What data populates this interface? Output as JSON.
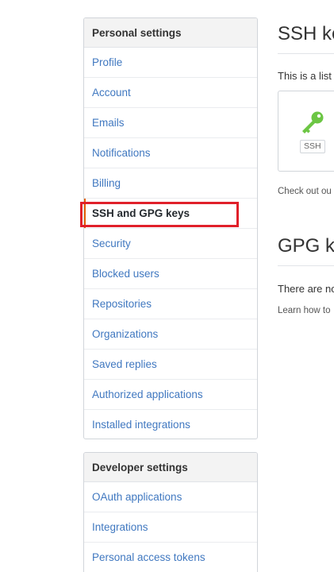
{
  "personal_settings": {
    "heading": "Personal settings",
    "items": [
      {
        "label": "Profile"
      },
      {
        "label": "Account"
      },
      {
        "label": "Emails"
      },
      {
        "label": "Notifications"
      },
      {
        "label": "Billing"
      },
      {
        "label": "SSH and GPG keys",
        "selected": true
      },
      {
        "label": "Security"
      },
      {
        "label": "Blocked users"
      },
      {
        "label": "Repositories"
      },
      {
        "label": "Organizations"
      },
      {
        "label": "Saved replies"
      },
      {
        "label": "Authorized applications"
      },
      {
        "label": "Installed integrations"
      }
    ]
  },
  "developer_settings": {
    "heading": "Developer settings",
    "items": [
      {
        "label": "OAuth applications"
      },
      {
        "label": "Integrations"
      },
      {
        "label": "Personal access tokens"
      }
    ]
  },
  "ssh_section": {
    "title": "SSH ke",
    "description": "This is a list",
    "key_badge": "SSH",
    "footnote": "Check out ou"
  },
  "gpg_section": {
    "title": "GPG ke",
    "description": "There are no",
    "footnote": "Learn how to"
  },
  "colors": {
    "link": "#4078c0",
    "selected_accent": "#e36209",
    "highlight_box": "#e0202a",
    "key_icon": "#6cc644"
  }
}
